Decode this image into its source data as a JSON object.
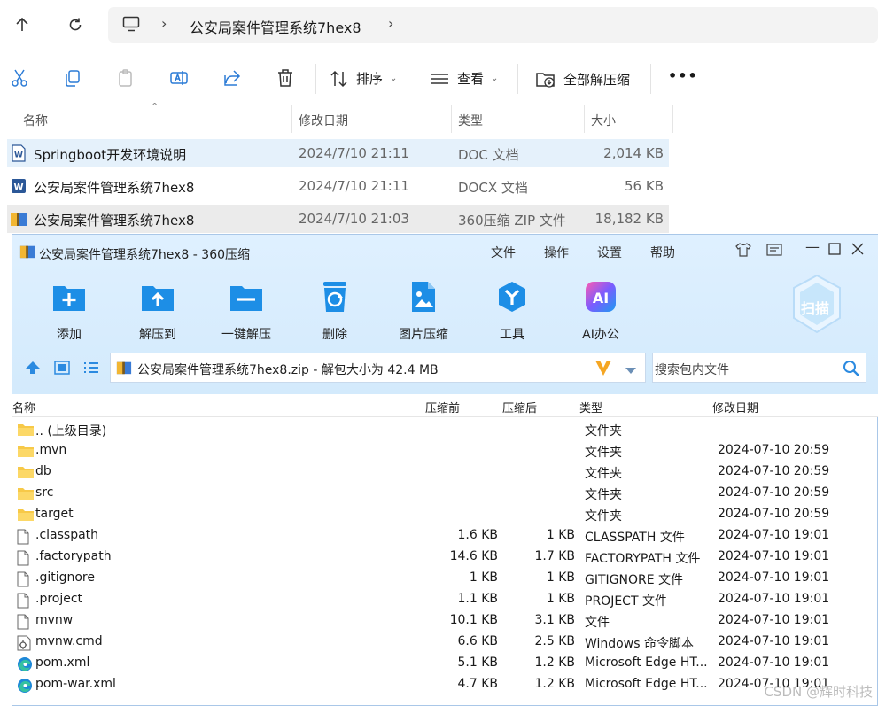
{
  "explorer": {
    "breadcrumb": [
      "公安局案件管理系统7hex8"
    ],
    "toolbar": {
      "sort_label": "排序",
      "view_label": "查看",
      "extract_all_label": "全部解压缩",
      "more_label": "•••"
    },
    "columns": [
      "名称",
      "修改日期",
      "类型",
      "大小"
    ],
    "files": [
      {
        "name": "Springboot开发环境说明",
        "date": "2024/7/10 21:11",
        "type": "DOC 文档",
        "size": "2,014 KB",
        "icon": "word-icon"
      },
      {
        "name": "公安局案件管理系统7hex8",
        "date": "2024/7/10 21:11",
        "type": "DOCX 文档",
        "size": "56 KB",
        "icon": "word-icon"
      },
      {
        "name": "公安局案件管理系统7hex8",
        "date": "2024/7/10 21:03",
        "type": "360压缩 ZIP 文件",
        "size": "18,182 KB",
        "icon": "zip-icon"
      }
    ]
  },
  "zip": {
    "title": "公安局案件管理系统7hex8 - 360压缩",
    "menu": [
      "文件",
      "操作",
      "设置",
      "帮助"
    ],
    "tools": [
      {
        "label": "添加",
        "icon": "add-folder-icon"
      },
      {
        "label": "解压到",
        "icon": "extract-to-icon"
      },
      {
        "label": "一键解压",
        "icon": "one-click-extract-icon"
      },
      {
        "label": "删除",
        "icon": "recycle-icon"
      },
      {
        "label": "图片压缩",
        "icon": "image-compress-icon"
      },
      {
        "label": "工具",
        "icon": "tools-icon"
      },
      {
        "label": "AI办公",
        "icon": "ai-icon"
      }
    ],
    "scan_label": "扫描",
    "path_text": "公安局案件管理系统7hex8.zip - 解包大小为 42.4 MB",
    "search_placeholder": "搜索包内文件",
    "columns": [
      "名称",
      "压缩前",
      "压缩后",
      "类型",
      "修改日期"
    ],
    "rows": [
      {
        "name": ".. (上级目录)",
        "before": "",
        "after": "",
        "type": "文件夹",
        "date": "",
        "icon": "folder-icon"
      },
      {
        "name": ".mvn",
        "before": "",
        "after": "",
        "type": "文件夹",
        "date": "2024-07-10 20:59",
        "icon": "folder-icon"
      },
      {
        "name": "db",
        "before": "",
        "after": "",
        "type": "文件夹",
        "date": "2024-07-10 20:59",
        "icon": "folder-icon"
      },
      {
        "name": "src",
        "before": "",
        "after": "",
        "type": "文件夹",
        "date": "2024-07-10 20:59",
        "icon": "folder-icon"
      },
      {
        "name": "target",
        "before": "",
        "after": "",
        "type": "文件夹",
        "date": "2024-07-10 20:59",
        "icon": "folder-icon"
      },
      {
        "name": ".classpath",
        "before": "1.6 KB",
        "after": "1 KB",
        "type": "CLASSPATH 文件",
        "date": "2024-07-10 19:01",
        "icon": "file-icon"
      },
      {
        "name": ".factorypath",
        "before": "14.6 KB",
        "after": "1.7 KB",
        "type": "FACTORYPATH 文件",
        "date": "2024-07-10 19:01",
        "icon": "file-icon"
      },
      {
        "name": ".gitignore",
        "before": "1 KB",
        "after": "1 KB",
        "type": "GITIGNORE 文件",
        "date": "2024-07-10 19:01",
        "icon": "file-icon"
      },
      {
        "name": ".project",
        "before": "1.1 KB",
        "after": "1 KB",
        "type": "PROJECT 文件",
        "date": "2024-07-10 19:01",
        "icon": "file-icon"
      },
      {
        "name": "mvnw",
        "before": "10.1 KB",
        "after": "3.1 KB",
        "type": "文件",
        "date": "2024-07-10 19:01",
        "icon": "file-icon"
      },
      {
        "name": "mvnw.cmd",
        "before": "6.6 KB",
        "after": "2.5 KB",
        "type": "Windows 命令脚本",
        "date": "2024-07-10 19:01",
        "icon": "cmd-script-icon"
      },
      {
        "name": "pom.xml",
        "before": "5.1 KB",
        "after": "1.2 KB",
        "type": "Microsoft Edge HT...",
        "date": "2024-07-10 19:01",
        "icon": "edge-icon"
      },
      {
        "name": "pom-war.xml",
        "before": "4.7 KB",
        "after": "1.2 KB",
        "type": "Microsoft Edge HT...",
        "date": "2024-07-10 19:01",
        "icon": "edge-icon"
      }
    ]
  },
  "watermark": "CSDN @辉时科技"
}
